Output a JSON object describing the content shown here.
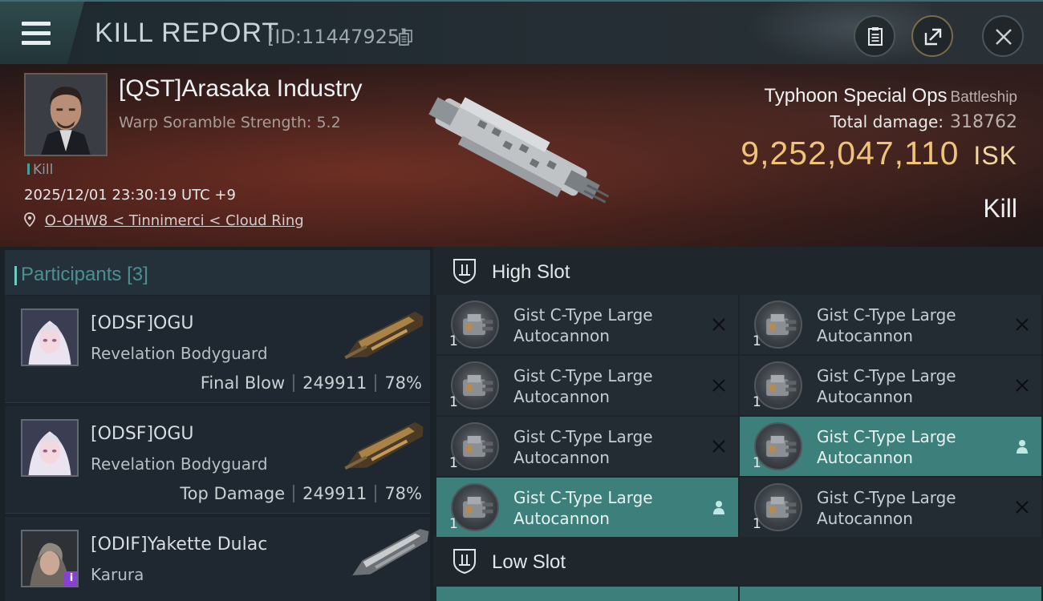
{
  "header": {
    "title": "KILL REPORT",
    "report_id": "[ID:11447925]"
  },
  "victim": {
    "name": "[QST]Arasaka Industry",
    "warp_scramble": "Warp Soramble Strength: 5.2",
    "tag": "Kill",
    "time": "2025/12/01 23:30:19 UTC +9",
    "location": "O-OHW8 < Tinnimerci < Cloud Ring"
  },
  "ship": {
    "name": "Typhoon Special Ops",
    "class": "Battleship",
    "total_damage_label": "Total damage:",
    "total_damage": "318762",
    "isk_value": "9,252,047,110",
    "isk_unit": "ISK",
    "result": "Kill"
  },
  "participants": {
    "label": "Participants",
    "count": "[3]",
    "items": [
      {
        "name": "[ODSF]OGU",
        "ship": "Revelation Bodyguard",
        "role": "Final Blow",
        "damage": "249911",
        "percent": "78%"
      },
      {
        "name": "[ODSF]OGU",
        "ship": "Revelation Bodyguard",
        "role": "Top Damage",
        "damage": "249911",
        "percent": "78%"
      },
      {
        "name": "[ODIF]Yakette Dulac",
        "ship": "Karura",
        "badge": "i"
      }
    ]
  },
  "slots": {
    "high": {
      "label": "High Slot",
      "modules": [
        {
          "line1": "Gist C-Type Large",
          "line2": "Autocannon",
          "qty": "1",
          "status": "destroyed"
        },
        {
          "line1": "Gist C-Type Large",
          "line2": "Autocannon",
          "qty": "1",
          "status": "destroyed"
        },
        {
          "line1": "Gist C-Type Large",
          "line2": "Autocannon",
          "qty": "1",
          "status": "destroyed"
        },
        {
          "line1": "Gist C-Type Large",
          "line2": "Autocannon",
          "qty": "1",
          "status": "destroyed"
        },
        {
          "line1": "Gist C-Type Large",
          "line2": "Autocannon",
          "qty": "1",
          "status": "destroyed"
        },
        {
          "line1": "Gist C-Type Large",
          "line2": "Autocannon",
          "qty": "1",
          "status": "dropped"
        },
        {
          "line1": "Gist C-Type Large",
          "line2": "Autocannon",
          "qty": "1",
          "status": "dropped"
        },
        {
          "line1": "Gist C-Type Large",
          "line2": "Autocannon",
          "qty": "1",
          "status": "destroyed"
        }
      ]
    },
    "low": {
      "label": "Low Slot"
    }
  },
  "colors": {
    "accent_teal": "#3d7f7a",
    "isk_gold": "#f0c37a",
    "destroyed_x": "#0c0f12",
    "dropped_icon": "#bfe8e2"
  }
}
